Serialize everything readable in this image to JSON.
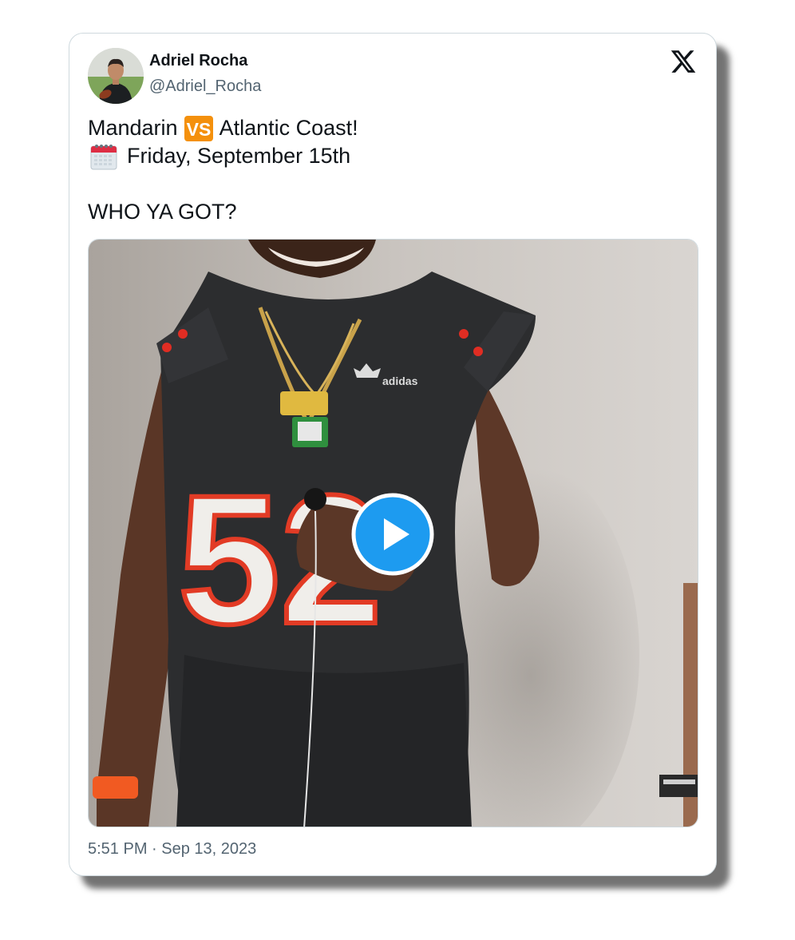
{
  "tweet": {
    "author_name": "Adriel Rocha",
    "author_handle": "@Adriel_Rocha",
    "text_lines": {
      "line1_before": "Mandarin",
      "line1_badge": "VS",
      "line1_after": "Atlantic Coast!",
      "line2": "Friday, September 15th",
      "line4": "WHO YA GOT?"
    },
    "timestamp": "5:51 PM · Sep 13, 2023",
    "jersey_number": "52"
  },
  "icons": {
    "platform_logo": "x-logo-icon",
    "play": "play-icon",
    "calendar": "calendar-icon",
    "vs": "vs-badge-icon"
  },
  "colors": {
    "text_primary": "#0f1419",
    "text_secondary": "#536471",
    "border": "#cfd9de",
    "play_button": "#1d9bf0",
    "vs_badge": "#f4900c"
  }
}
